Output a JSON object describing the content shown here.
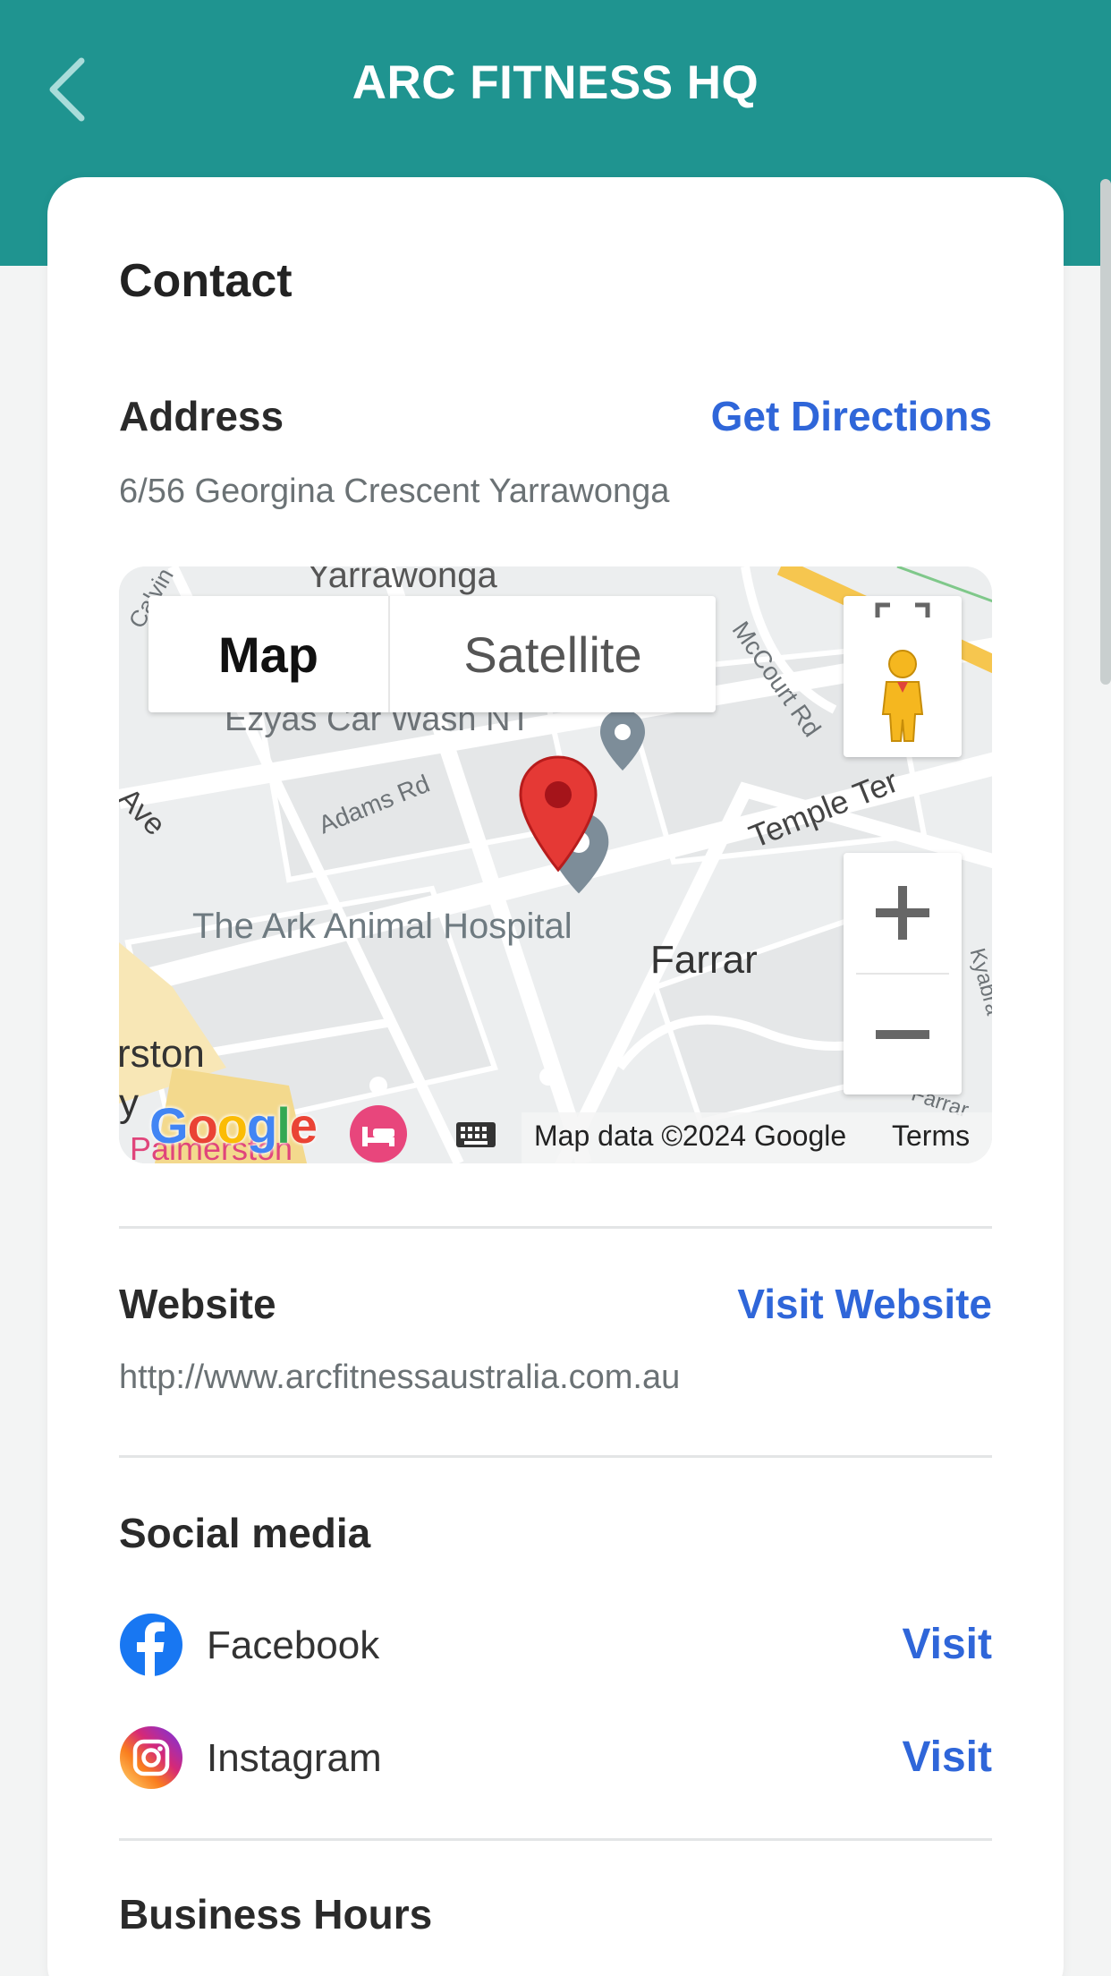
{
  "header": {
    "title": "ARC FITNESS HQ"
  },
  "contact": {
    "heading": "Contact",
    "address_label": "Address",
    "directions_link": "Get Directions",
    "address": "6/56 Georgina Crescent Yarrawonga"
  },
  "map": {
    "toggle_map": "Map",
    "toggle_satellite": "Satellite",
    "labels": {
      "yarrawonga": "Yarrawonga",
      "calvin": "Calvin",
      "car_wash": "Ezyas Car Wash NT",
      "adams_rd": "Adams Rd",
      "mccourt_rd": "McCourt Rd",
      "temple_ter": "Temple Ter",
      "ave": "Ave",
      "hospital": "The Ark Animal Hospital",
      "farrar": "Farrar",
      "rston": "rston",
      "y": "y",
      "palmerston": "Palmerston",
      "kyabra": "Kyabra",
      "farrar_small": "Farrar"
    },
    "google_logo": "Google",
    "attribution": "Map data ©2024 Google",
    "terms": "Terms"
  },
  "website": {
    "label": "Website",
    "link": "Visit Website",
    "url": "http://www.arcfitnessaustralia.com.au"
  },
  "social": {
    "label": "Social media",
    "items": [
      {
        "name": "Facebook",
        "action": "Visit"
      },
      {
        "name": "Instagram",
        "action": "Visit"
      }
    ]
  },
  "hours": {
    "label": "Business Hours"
  },
  "colors": {
    "header": "#1f9490",
    "link": "#2f66d9",
    "pin": "#e53935"
  }
}
